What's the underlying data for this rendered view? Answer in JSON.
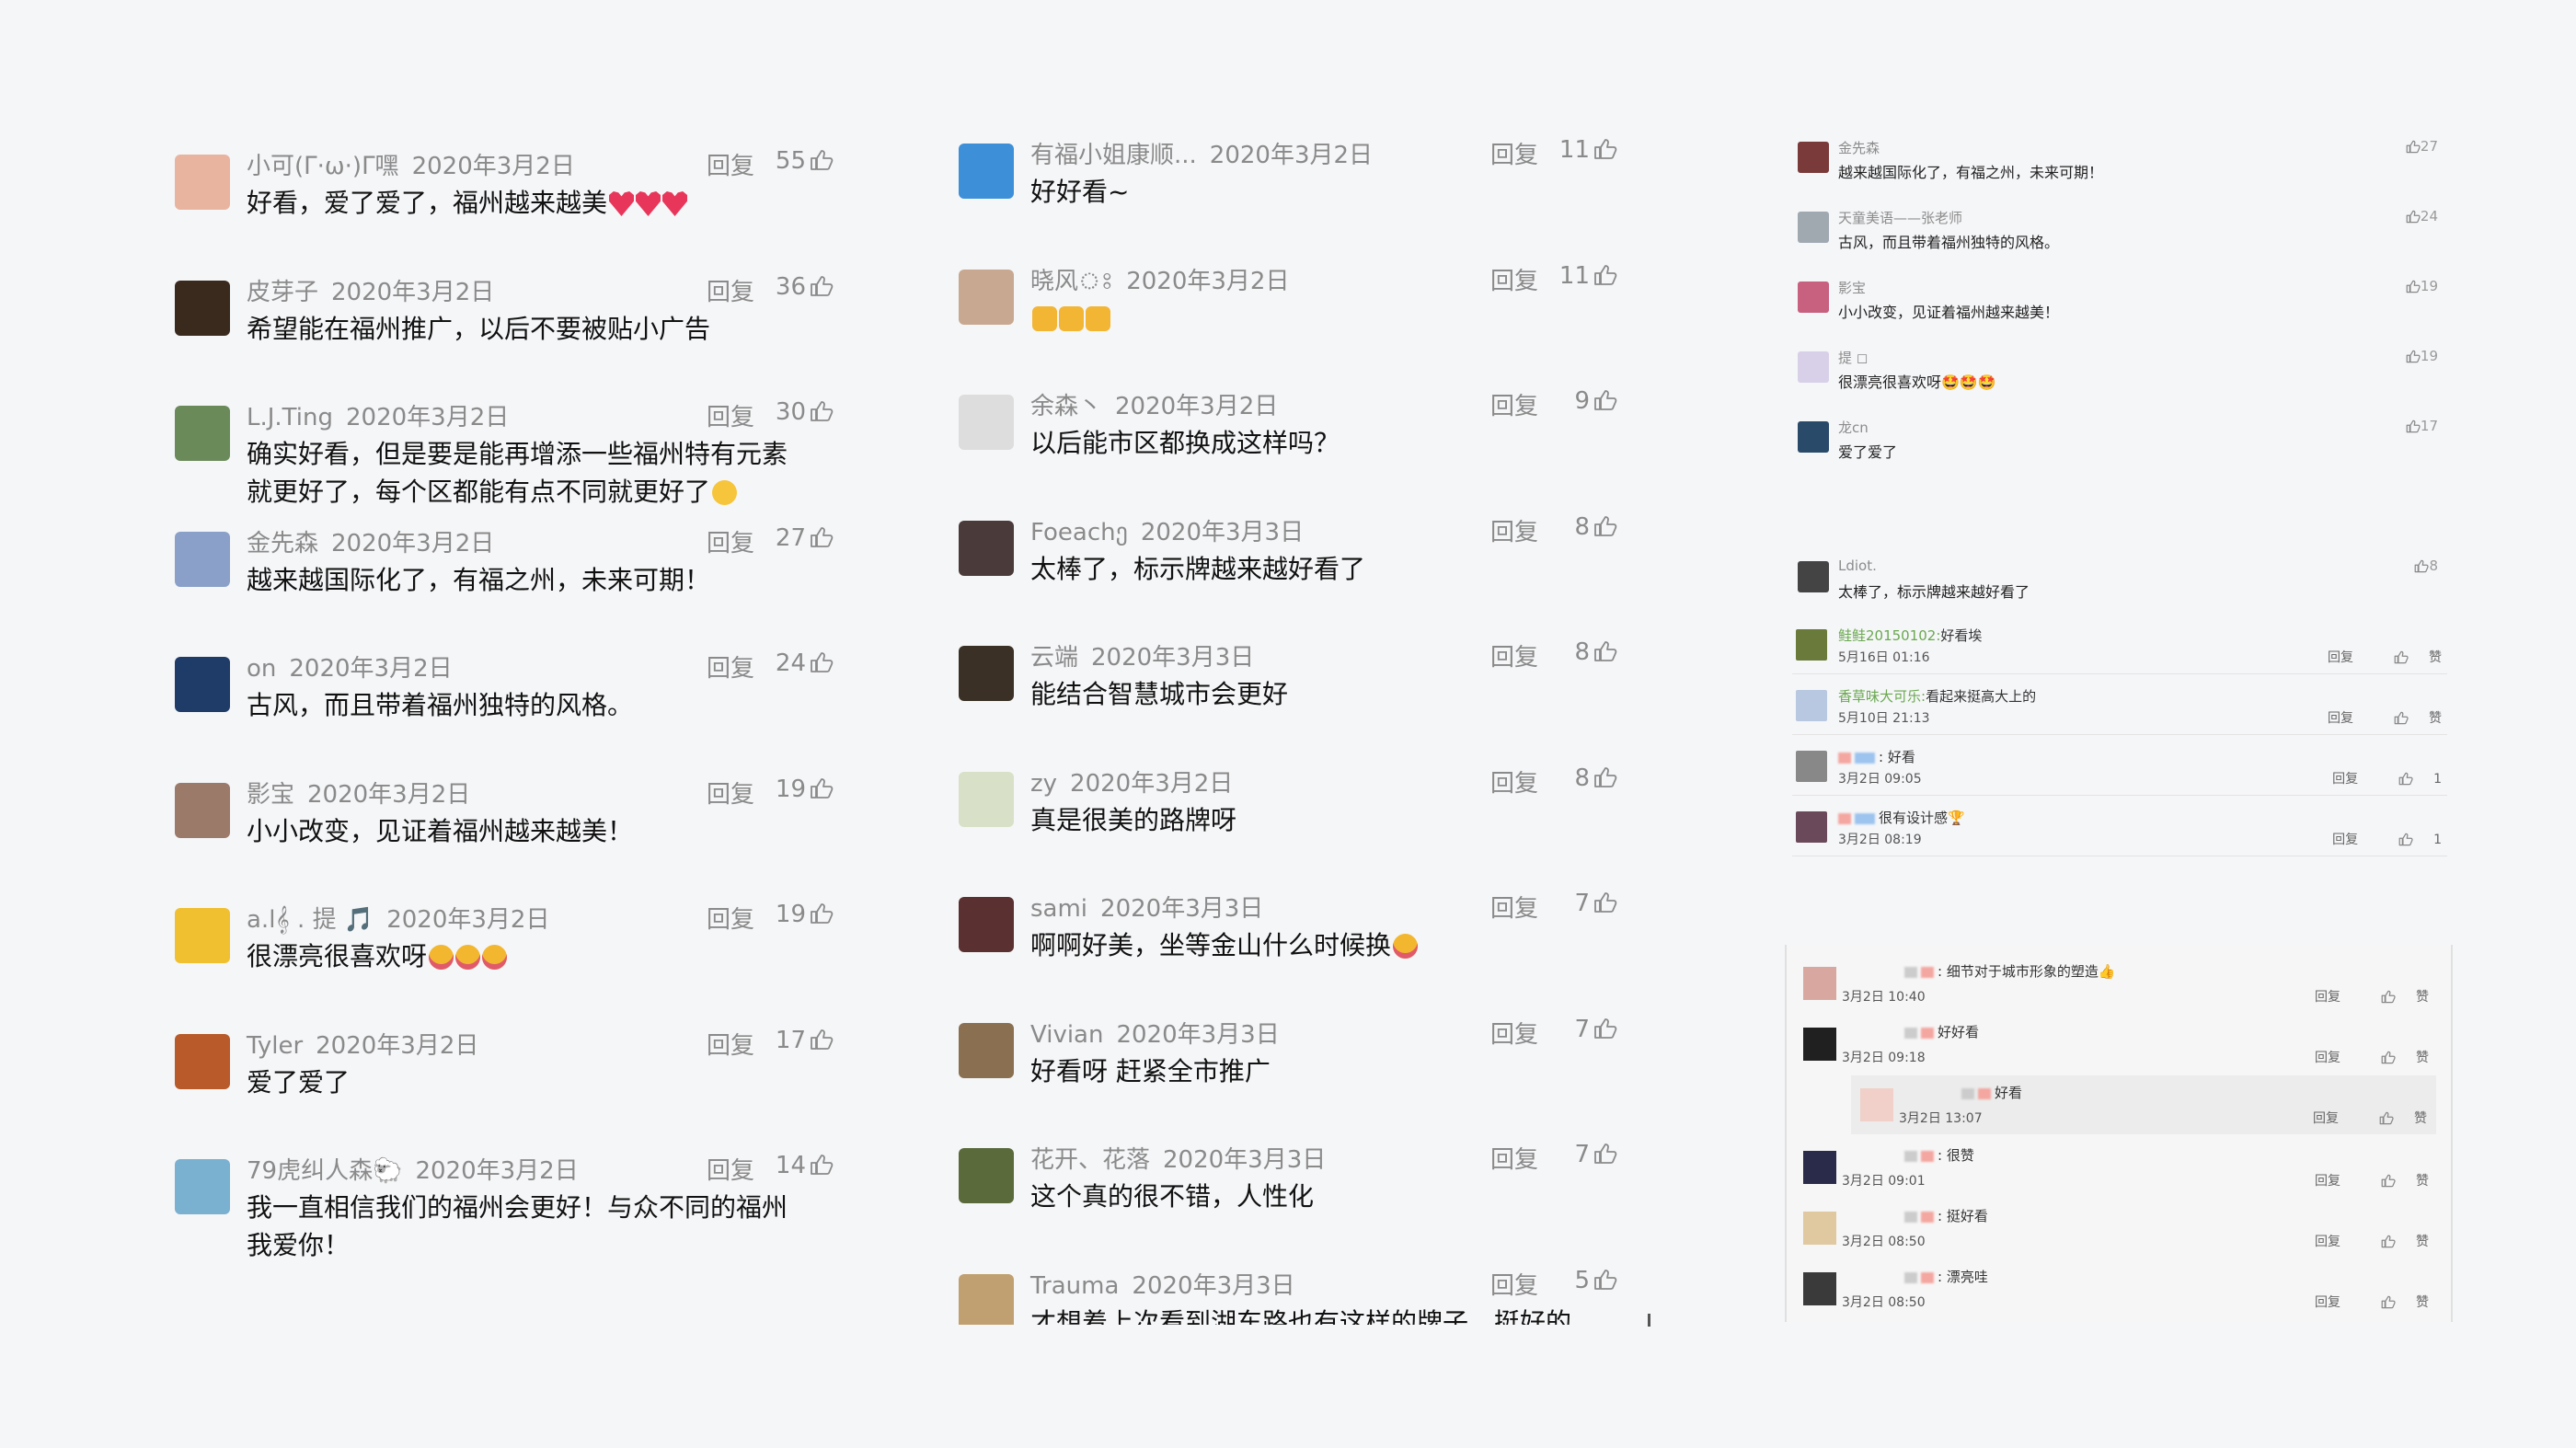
{
  "reply_label": "回复",
  "like_label": "赞",
  "column1": [
    {
      "name": "小可(ᒥ·ω·)ᒥ嘿",
      "date": "2020年3月2日",
      "text": "好看，爱了爱了，福州越来越美",
      "emoji": [
        "heart",
        "heart",
        "heart"
      ],
      "likes": "55",
      "avatar": "#e8b4a0"
    },
    {
      "name": "皮芽子",
      "date": "2020年3月2日",
      "text": "希望能在福州推广，以后不要被贴小广告",
      "emoji": [],
      "likes": "36",
      "avatar": "#3a2a1e"
    },
    {
      "name": "L.J.Ting",
      "date": "2020年3月2日",
      "text": "确实好看，但是要是能再增添一些福州特有元素就更好了，每个区都能有点不同就更好了",
      "emoji": [
        "grin"
      ],
      "likes": "30",
      "avatar": "#6b8a5a"
    },
    {
      "name": "金先森",
      "date": "2020年3月2日",
      "text": "越来越国际化了，有福之州，未来可期！",
      "emoji": [],
      "likes": "27",
      "avatar": "#8aa0c8"
    },
    {
      "name": "on",
      "date": "2020年3月2日",
      "text": "古风，而且带着福州独特的风格。",
      "emoji": [],
      "likes": "24",
      "avatar": "#1f3b68"
    },
    {
      "name": "影宝",
      "date": "2020年3月2日",
      "text": "小小改变，见证着福州越来越美！",
      "emoji": [],
      "likes": "19",
      "avatar": "#9b7a6a"
    },
    {
      "name": "a.l𝄞 . 提 🎵",
      "date": "2020年3月2日",
      "text": "很漂亮很喜欢呀",
      "emoji": [
        "starry",
        "starry",
        "starry"
      ],
      "likes": "19",
      "avatar": "#f0c030"
    },
    {
      "name": "Tyler",
      "date": "2020年3月2日",
      "text": "爱了爱了",
      "emoji": [],
      "likes": "17",
      "avatar": "#b85a2a"
    },
    {
      "name": "79虎纠人森🐑",
      "date": "2020年3月2日",
      "text": "我一直相信我们的福州会更好！与众不同的福州我爱你！",
      "emoji": [],
      "likes": "14",
      "avatar": "#7ab0d0"
    }
  ],
  "column2": [
    {
      "name": "有福小姐康顺...",
      "date": "2020年3月2日",
      "text": "好好看~",
      "emoji": [],
      "likes": "11",
      "avatar": "#3d8fd8"
    },
    {
      "name": "晓风ঃ",
      "date": "2020年3月2日",
      "text": "",
      "emoji": [
        "thumbup",
        "thumbup",
        "thumbup"
      ],
      "likes": "11",
      "avatar": "#c8a890"
    },
    {
      "name": "余森丶",
      "date": "2020年3月2日",
      "text": "以后能市区都换成这样吗？",
      "emoji": [],
      "likes": "9",
      "avatar": "#dddddd"
    },
    {
      "name": "Foeachე",
      "date": "2020年3月3日",
      "text": "太棒了，标示牌越来越好看了",
      "emoji": [],
      "likes": "8",
      "avatar": "#4a3a3a"
    },
    {
      "name": "云端",
      "date": "2020年3月3日",
      "text": "能结合智慧城市会更好",
      "emoji": [],
      "likes": "8",
      "avatar": "#3a3025"
    },
    {
      "name": "zy",
      "date": "2020年3月2日",
      "text": "真是很美的路牌呀",
      "emoji": [],
      "likes": "8",
      "avatar": "#d8e0c8"
    },
    {
      "name": "sami",
      "date": "2020年3月3日",
      "text": "啊啊好美，坐等金山什么时候换",
      "emoji": [
        "starry"
      ],
      "likes": "7",
      "avatar": "#5a3030"
    },
    {
      "name": "Vivian",
      "date": "2020年3月3日",
      "text": "好看呀 赶紧全市推广",
      "emoji": [],
      "likes": "7",
      "avatar": "#8a7050"
    },
    {
      "name": "花开、花落",
      "date": "2020年3月3日",
      "text": "这个真的很不错，人性化",
      "emoji": [],
      "likes": "7",
      "avatar": "#5a6a3a"
    },
    {
      "name": "Trauma",
      "date": "2020年3月3日",
      "text": "才想着上次看到湖东路也有这样的牌子，挺好的",
      "emoji": [],
      "likes": "5",
      "avatar": "#c0a070"
    }
  ],
  "panel3_top": [
    {
      "name": "金先森",
      "text": "越来越国际化了，有福之州，未来可期！",
      "likes": "27",
      "avatar": "#7a3a3a"
    },
    {
      "name": "天童美语——张老师",
      "text": "古风，而且带着福州独特的风格。",
      "likes": "24",
      "avatar": "#a0a8b0"
    },
    {
      "name": "影宝",
      "text": "小小改变，见证着福州越来越美！",
      "likes": "19",
      "avatar": "#c86080"
    },
    {
      "name": "提 ◻",
      "text": "很漂亮很喜欢呀🤩🤩🤩",
      "likes": "19",
      "avatar": "#d8d0e8"
    },
    {
      "name": "龙cn",
      "text": "爱了爱了",
      "likes": "17",
      "avatar": "#2a4a6a"
    },
    {
      "name": "Ldiot.",
      "text": "太棒了，标示牌越来越好看了",
      "likes": "8",
      "avatar": "#444444"
    }
  ],
  "panel3_mid": [
    {
      "name": "鲑鲑20150102:",
      "text": "好看埃",
      "time": "5月16日 01:16",
      "likes": "赞",
      "avatar": "#6a7a3a"
    },
    {
      "name": "香草味大可乐:",
      "text": "看起来挺高大上的",
      "time": "5月10日 21:13",
      "likes": "赞",
      "avatar": "#b8c8e0"
    },
    {
      "name": "",
      "text": ": 好看",
      "time": "3月2日 09:05",
      "likes": "1",
      "avatar": "#888888"
    },
    {
      "name": "",
      "text": "很有设计感🏆",
      "time": "3月2日 08:19",
      "likes": "1",
      "avatar": "#6a4a5a"
    }
  ],
  "panel3_bottom": [
    {
      "text": ": 细节对于城市形象的塑造👍",
      "time": "3月2日 10:40",
      "likes": "赞",
      "avatar": "#d8a8a0"
    },
    {
      "text": "好好看",
      "time": "3月2日 09:18",
      "likes": "赞",
      "avatar": "#202020"
    },
    {
      "text": "好看",
      "time": "3月2日 13:07",
      "likes": "赞",
      "avatar": "#f0d0c8"
    },
    {
      "text": ": 很赞",
      "time": "3月2日 09:01",
      "likes": "赞",
      "avatar": "#2a2a4a"
    },
    {
      "text": ": 挺好看",
      "time": "3月2日 08:50",
      "likes": "赞",
      "avatar": "#e0c8a0"
    },
    {
      "text": ": 漂亮哇",
      "time": "3月2日 08:50",
      "likes": "赞",
      "avatar": "#3a3a3a"
    }
  ]
}
